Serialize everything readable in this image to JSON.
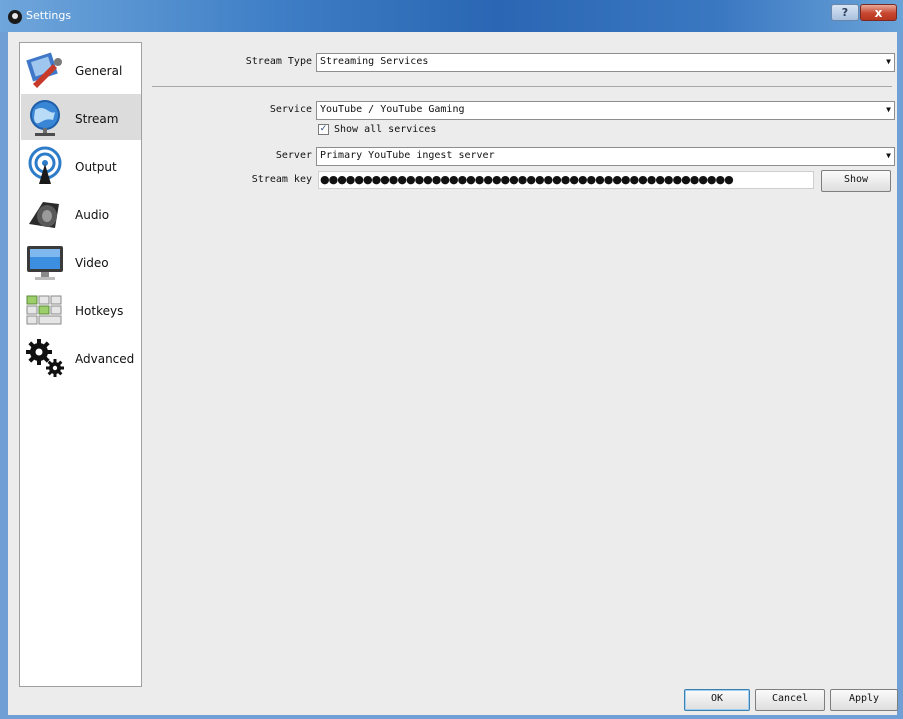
{
  "window": {
    "title": "Settings",
    "help_label": "?",
    "close_label": "x"
  },
  "sidebar": {
    "items": [
      {
        "label": "General",
        "icon": "general-icon",
        "active": false
      },
      {
        "label": "Stream",
        "icon": "stream-globe-icon",
        "active": true
      },
      {
        "label": "Output",
        "icon": "output-broadcast-icon",
        "active": false
      },
      {
        "label": "Audio",
        "icon": "audio-speaker-icon",
        "active": false
      },
      {
        "label": "Video",
        "icon": "video-monitor-icon",
        "active": false
      },
      {
        "label": "Hotkeys",
        "icon": "hotkeys-keyboard-icon",
        "active": false
      },
      {
        "label": "Advanced",
        "icon": "advanced-gears-icon",
        "active": false
      }
    ]
  },
  "stream": {
    "stream_type_label": "Stream Type",
    "stream_type_value": "Streaming Services",
    "service_label": "Service",
    "service_value": "YouTube / YouTube Gaming",
    "show_all_label": "Show all services",
    "show_all_checked": true,
    "server_label": "Server",
    "server_value": "Primary YouTube ingest server",
    "stream_key_label": "Stream key",
    "stream_key_mask": "●●●●●●●●●●●●●●●●●●●●●●●●●●●●●●●●●●●●●●●●●●●●●●●●",
    "show_button": "Show"
  },
  "footer": {
    "ok": "OK",
    "cancel": "Cancel",
    "apply": "Apply"
  }
}
